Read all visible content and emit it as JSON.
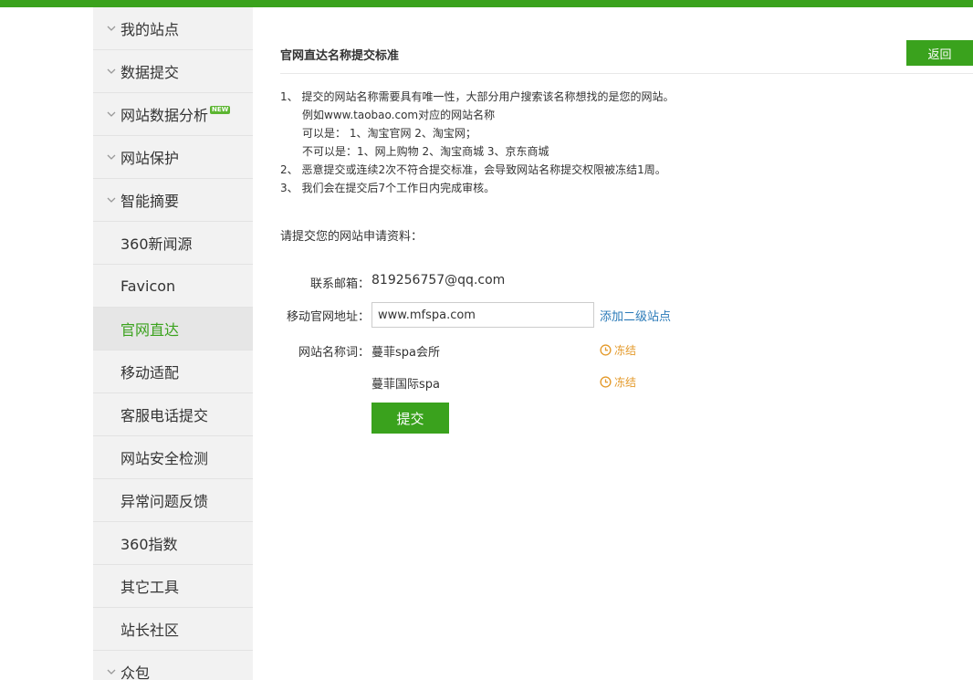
{
  "sidebar": {
    "items": [
      {
        "label": "我的站点",
        "expandable": true
      },
      {
        "label": "数据提交",
        "expandable": true
      },
      {
        "label": "网站数据分析",
        "expandable": true,
        "badge": "NEW"
      },
      {
        "label": "网站保护",
        "expandable": true
      },
      {
        "label": "智能摘要",
        "expandable": true
      },
      {
        "label": "360新闻源"
      },
      {
        "label": "Favicon"
      },
      {
        "label": "官网直达",
        "active": true
      },
      {
        "label": "移动适配"
      },
      {
        "label": "客服电话提交"
      },
      {
        "label": "网站安全检测"
      },
      {
        "label": "异常问题反馈"
      },
      {
        "label": "360指数"
      },
      {
        "label": "其它工具"
      },
      {
        "label": "站长社区"
      },
      {
        "label": "众包",
        "expandable": true
      }
    ]
  },
  "main": {
    "title": "官网直达名称提交标准",
    "back_label": "返回",
    "rules": [
      "1、  提交的网站名称需要具有唯一性，大部分用户搜索该名称想找的是您的网站。",
      "例如www.taobao.com对应的网站名称",
      "可以是： 1、淘宝官网 2、淘宝网；",
      "不可以是：1、网上购物 2、淘宝商城 3、京东商城",
      "2、  恶意提交或连续2次不符合提交标准，会导致网站名称提交权限被冻结1周。",
      "3、  我们会在提交后7个工作日内完成审核。"
    ],
    "prompt": "请提交您的网站申请资料：",
    "email_label": "联系邮箱：",
    "email_value": "819256757@qq.com",
    "url_label": "移动官网地址：",
    "url_value": "www.mfspa.com",
    "add_subsite_label": "添加二级站点",
    "keyword_label": "网站名称词：",
    "keywords": [
      {
        "name": "蔓菲spa会所",
        "status": "冻结"
      },
      {
        "name": "蔓菲国际spa",
        "status": "冻结"
      }
    ],
    "submit_label": "提交"
  },
  "colors": {
    "accent": "#3aa21d",
    "link": "#2a7ab8",
    "freeze": "#e49a2b"
  }
}
